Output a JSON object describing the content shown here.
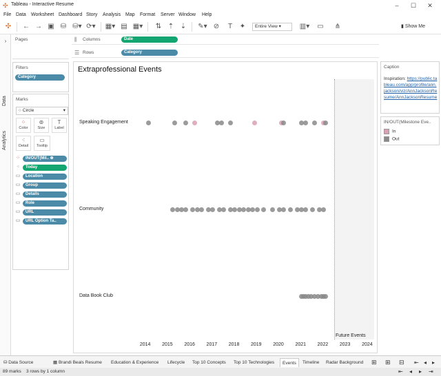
{
  "window": {
    "title": "Tableau - Interactive Resume"
  },
  "menu": [
    "File",
    "Data",
    "Worksheet",
    "Dashboard",
    "Story",
    "Analysis",
    "Map",
    "Format",
    "Server",
    "Window",
    "Help"
  ],
  "toolbar": {
    "fit": "Entire View",
    "show_me": "Show Me"
  },
  "side_tabs": {
    "data": "Data",
    "analytics": "Analytics"
  },
  "pages": {
    "title": "Pages"
  },
  "filters": {
    "title": "Filters",
    "pills": [
      "Category"
    ]
  },
  "marks": {
    "title": "Marks",
    "type": "Circle",
    "buttons": {
      "color": "Color",
      "size": "Size",
      "label": "Label",
      "detail": "Detail",
      "tooltip": "Tooltip"
    },
    "pills": [
      {
        "icon": "color-dots-icon",
        "label": "IN/OUT(Mil..",
        "color": "blue"
      },
      {
        "icon": "detail-icon",
        "label": "Today",
        "color": "green"
      },
      {
        "icon": "tooltip-icon",
        "label": "Location",
        "color": "blue"
      },
      {
        "icon": "tooltip-icon",
        "label": "Group",
        "color": "blue"
      },
      {
        "icon": "tooltip-icon",
        "label": "Details",
        "color": "blue"
      },
      {
        "icon": "tooltip-icon",
        "label": "Role",
        "color": "blue"
      },
      {
        "icon": "tooltip-icon",
        "label": "URL",
        "color": "blue"
      },
      {
        "icon": "tooltip-icon",
        "label": "URL Option Ta..",
        "color": "blue"
      }
    ]
  },
  "shelves": {
    "columns": {
      "label": "Columns",
      "pill": "Date"
    },
    "rows": {
      "label": "Rows",
      "pill": "Category"
    }
  },
  "viz": {
    "title": "Extraprofessional Events",
    "future_label": "Future Events",
    "colors": {
      "in": "#d9a0b5",
      "out": "#8a8a8a"
    }
  },
  "chart_data": {
    "type": "scatter",
    "title": "Extraprofessional Events",
    "xlabel": "",
    "ylabel": "",
    "x_ticks": [
      "2014",
      "2015",
      "2016",
      "2017",
      "2018",
      "2019",
      "2020",
      "2021",
      "2022",
      "2023",
      "2024"
    ],
    "xlim": [
      2013.6,
      2024.4
    ],
    "categories": [
      "Speaking Engagement",
      "Community",
      "Data Book Club"
    ],
    "series": [
      {
        "category": "Speaking Engagement",
        "points": [
          {
            "x": 2014.1,
            "status": "out"
          },
          {
            "x": 2015.3,
            "status": "out"
          },
          {
            "x": 2015.8,
            "status": "out"
          },
          {
            "x": 2016.2,
            "status": "in"
          },
          {
            "x": 2017.2,
            "status": "out"
          },
          {
            "x": 2017.4,
            "status": "out"
          },
          {
            "x": 2017.8,
            "status": "out"
          },
          {
            "x": 2018.9,
            "status": "in"
          },
          {
            "x": 2020.1,
            "status": "in"
          },
          {
            "x": 2020.2,
            "status": "out"
          },
          {
            "x": 2021.0,
            "status": "out"
          },
          {
            "x": 2021.2,
            "status": "out"
          },
          {
            "x": 2021.6,
            "status": "out"
          },
          {
            "x": 2022.0,
            "status": "in"
          },
          {
            "x": 2022.1,
            "status": "out"
          }
        ]
      },
      {
        "category": "Community",
        "points": [
          {
            "x": 2015.2,
            "status": "out"
          },
          {
            "x": 2015.4,
            "status": "out"
          },
          {
            "x": 2015.6,
            "status": "out"
          },
          {
            "x": 2015.8,
            "status": "out"
          },
          {
            "x": 2016.1,
            "status": "out"
          },
          {
            "x": 2016.3,
            "status": "out"
          },
          {
            "x": 2016.5,
            "status": "out"
          },
          {
            "x": 2016.8,
            "status": "out"
          },
          {
            "x": 2017.0,
            "status": "out"
          },
          {
            "x": 2017.3,
            "status": "out"
          },
          {
            "x": 2017.5,
            "status": "out"
          },
          {
            "x": 2017.8,
            "status": "out"
          },
          {
            "x": 2018.0,
            "status": "out"
          },
          {
            "x": 2018.2,
            "status": "out"
          },
          {
            "x": 2018.4,
            "status": "out"
          },
          {
            "x": 2018.6,
            "status": "out"
          },
          {
            "x": 2018.8,
            "status": "out"
          },
          {
            "x": 2019.0,
            "status": "out"
          },
          {
            "x": 2019.3,
            "status": "out"
          },
          {
            "x": 2019.7,
            "status": "out"
          },
          {
            "x": 2020.0,
            "status": "out"
          },
          {
            "x": 2020.2,
            "status": "out"
          },
          {
            "x": 2020.5,
            "status": "out"
          },
          {
            "x": 2020.8,
            "status": "out"
          },
          {
            "x": 2021.0,
            "status": "out"
          },
          {
            "x": 2021.2,
            "status": "out"
          },
          {
            "x": 2021.5,
            "status": "out"
          },
          {
            "x": 2021.8,
            "status": "out"
          },
          {
            "x": 2022.0,
            "status": "out"
          }
        ]
      },
      {
        "category": "Data Book Club",
        "points": [
          {
            "x": 2021.0,
            "status": "out"
          },
          {
            "x": 2021.1,
            "status": "out"
          },
          {
            "x": 2021.2,
            "status": "out"
          },
          {
            "x": 2021.3,
            "status": "out"
          },
          {
            "x": 2021.45,
            "status": "out"
          },
          {
            "x": 2021.6,
            "status": "out"
          },
          {
            "x": 2021.75,
            "status": "out"
          },
          {
            "x": 2021.9,
            "status": "out"
          },
          {
            "x": 2022.0,
            "status": "out"
          },
          {
            "x": 2022.1,
            "status": "out"
          }
        ]
      }
    ],
    "legend": {
      "title": "IN/OUT(Milestone Eve..",
      "entries": [
        {
          "label": "In",
          "color": "#d9a0b5"
        },
        {
          "label": "Out",
          "color": "#8a8a8a"
        }
      ],
      "position": "right"
    }
  },
  "caption": {
    "title": "Caption",
    "prefix": "Inspiration:",
    "link": "https://public.tableau.com/app/profile/ann.jackson/viz/AnnJacksonResume/AnnJacksonResume"
  },
  "sheet_tabs": [
    "Data Source",
    "Brandi Beals Resume",
    "Education & Experience",
    "Lifecycle",
    "Top 10 Concepts",
    "Top 10 Technologies",
    "Events",
    "Timeline",
    "Radar Background"
  ],
  "status": {
    "marks": "89 marks",
    "dims": "3 rows by 1 column"
  }
}
